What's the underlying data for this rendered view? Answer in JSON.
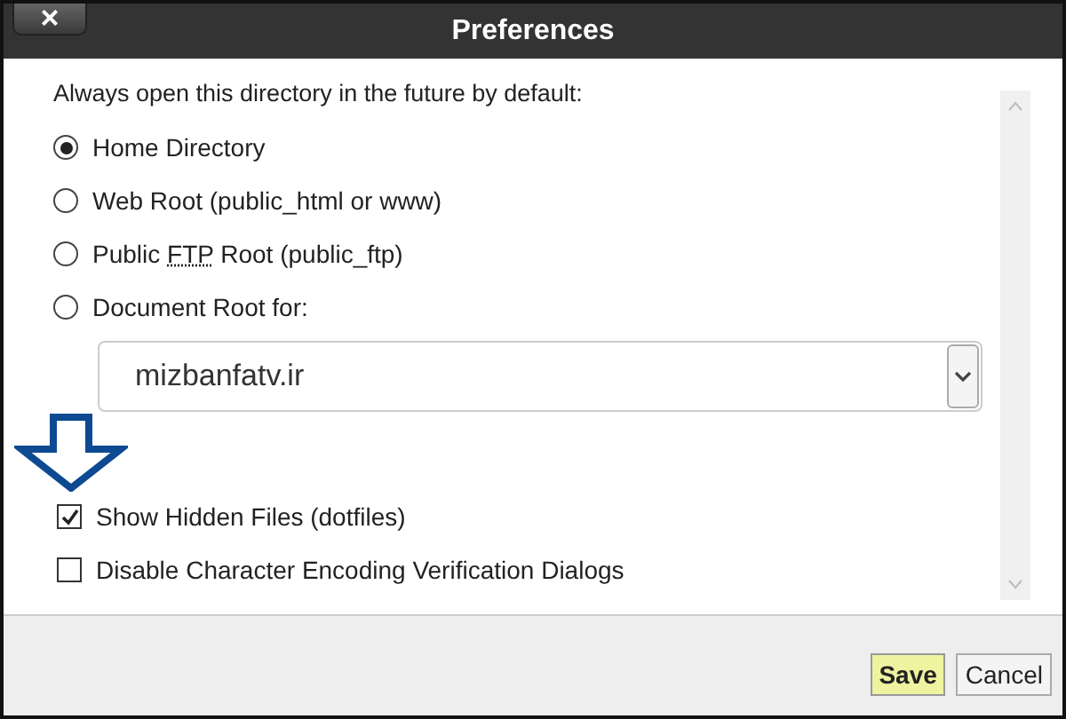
{
  "window": {
    "title": "Preferences",
    "close_label": "×"
  },
  "heading": "Always open this directory in the future by default:",
  "radios": [
    {
      "label": "Home Directory",
      "selected": true
    },
    {
      "label": "Web Root (public_html or www)",
      "selected": false
    },
    {
      "label": "Public ",
      "abbr": "FTP",
      "label_after": " Root (public_ftp)",
      "selected": false
    },
    {
      "label": "Document Root for:",
      "selected": false
    }
  ],
  "domain_select": {
    "value": "mizbanfatv.ir"
  },
  "checkboxes": [
    {
      "label": "Show Hidden Files (dotfiles)",
      "checked": true
    },
    {
      "label": "Disable Character Encoding Verification Dialogs",
      "checked": false
    }
  ],
  "buttons": [
    {
      "label": "Save",
      "kind": "primary"
    },
    {
      "label": "Cancel",
      "kind": "secondary"
    }
  ]
}
